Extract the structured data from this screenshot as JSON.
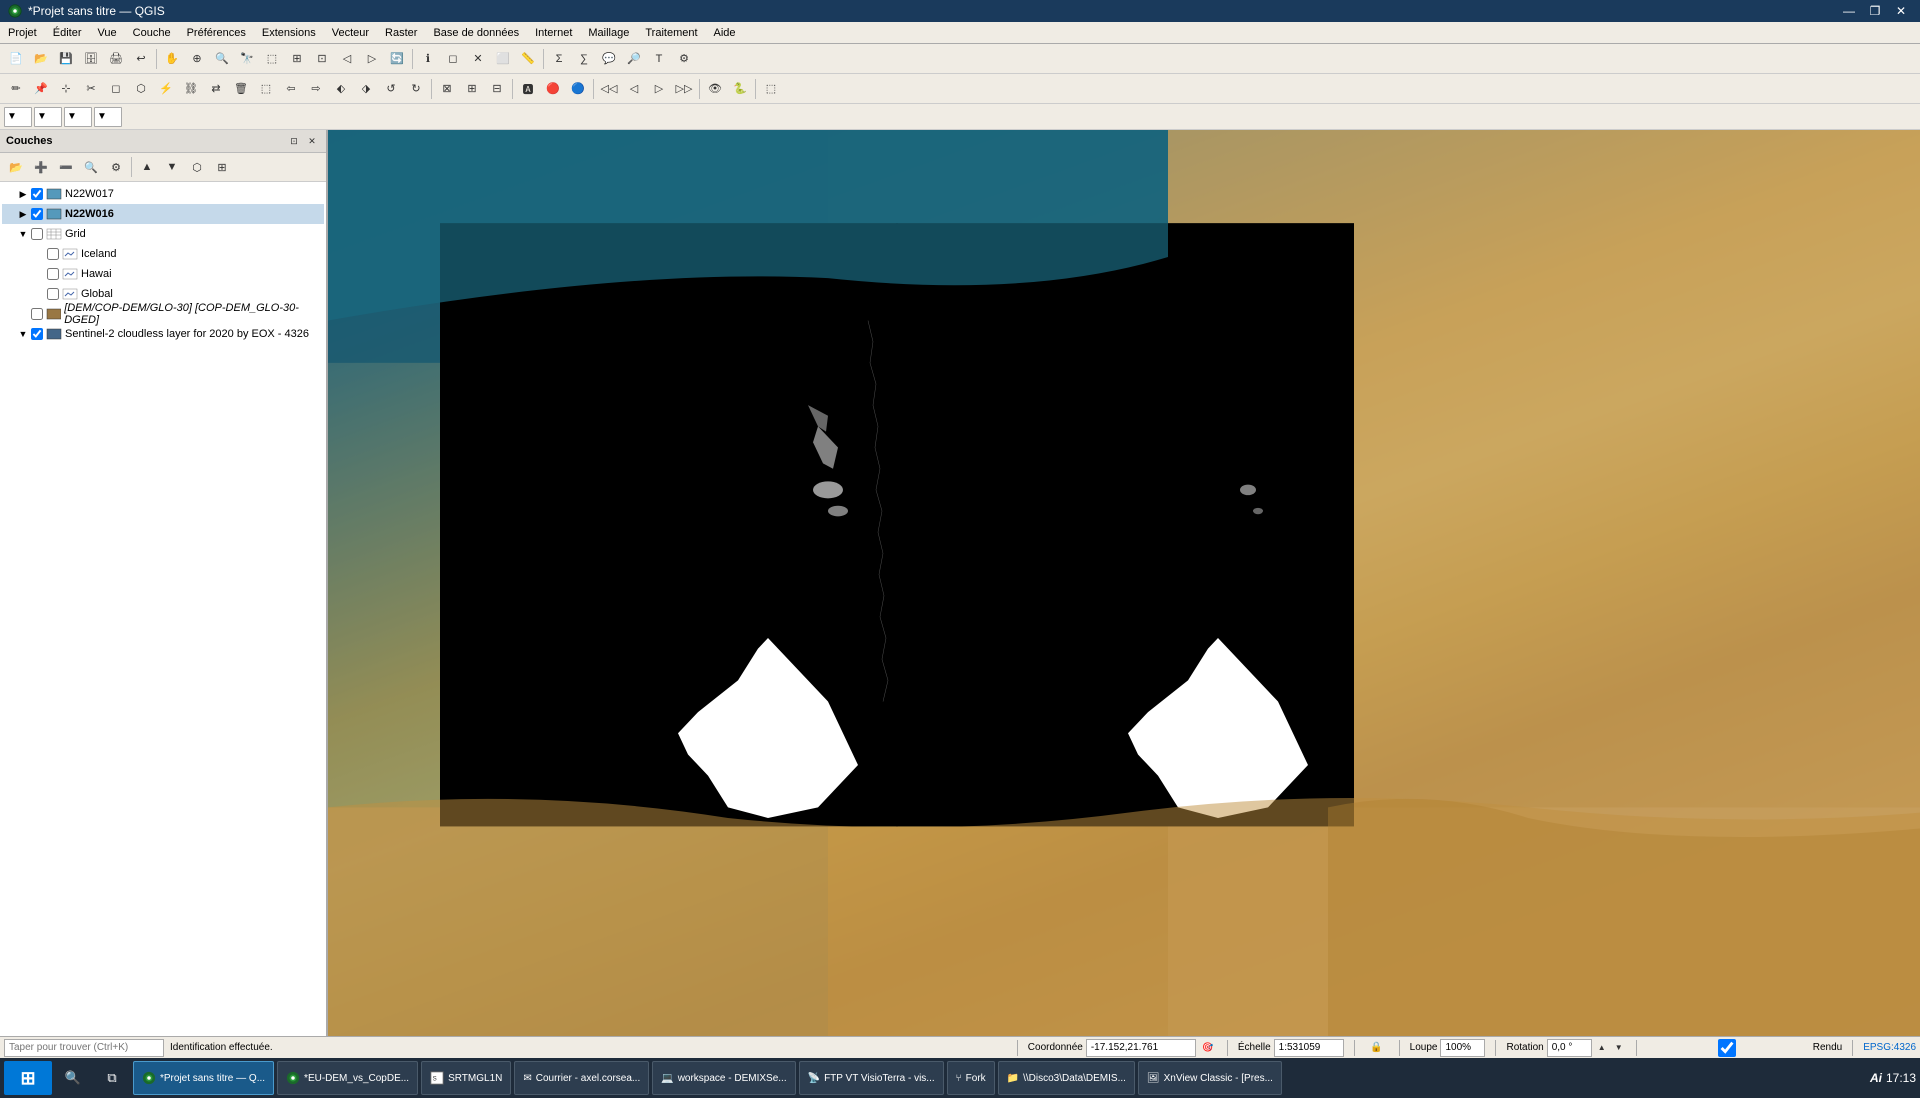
{
  "window": {
    "title": "*Projet sans titre — QGIS"
  },
  "titlebar": {
    "title": "*Projet sans titre — QGIS",
    "minimize": "—",
    "restore": "❐",
    "close": "✕"
  },
  "menubar": {
    "items": [
      "Projet",
      "Éditer",
      "Vue",
      "Couche",
      "Préférences",
      "Extensions",
      "Vecteur",
      "Raster",
      "Base de données",
      "Internet",
      "Maillage",
      "Traitement",
      "Aide"
    ]
  },
  "layers_panel": {
    "title": "Couches",
    "layers": [
      {
        "id": "N22W017",
        "name": "N22W017",
        "indent": 1,
        "checked": true,
        "type": "raster",
        "expanded": false
      },
      {
        "id": "N22W016",
        "name": "N22W016",
        "indent": 1,
        "checked": true,
        "type": "raster",
        "expanded": false,
        "selected": true
      },
      {
        "id": "Grid",
        "name": "Grid",
        "indent": 1,
        "checked": false,
        "type": "vector",
        "expanded": false
      },
      {
        "id": "Iceland",
        "name": "Iceland",
        "indent": 2,
        "checked": false,
        "type": "vector",
        "expanded": false
      },
      {
        "id": "Hawai",
        "name": "Hawai",
        "indent": 2,
        "checked": false,
        "type": "vector",
        "expanded": false
      },
      {
        "id": "Global",
        "name": "Global",
        "indent": 2,
        "checked": false,
        "type": "vector",
        "expanded": false
      },
      {
        "id": "DEM",
        "name": "[DEM/COP-DEM/GLO-30] [COP-DEM_GLO-30-DGED]",
        "indent": 1,
        "checked": false,
        "type": "raster-group",
        "expanded": false
      },
      {
        "id": "Sentinel",
        "name": "Sentinel-2 cloudless layer for 2020 by EOX - 4326",
        "indent": 1,
        "checked": true,
        "type": "raster",
        "expanded": true
      }
    ]
  },
  "statusbar": {
    "search_placeholder": "Taper pour trouver (Ctrl+K)",
    "identification": "Identification effectuée.",
    "coordonnee_label": "Coordonnée",
    "coordonnee_value": "-17.152,21.761",
    "echelle_label": "Échelle",
    "echelle_value": "1:531059",
    "loupe_label": "Loupe",
    "loupe_value": "100%",
    "rotation_label": "Rotation",
    "rotation_value": "0,0 °",
    "rendu_label": "Rendu",
    "epsg_label": "EPSG:4326"
  },
  "taskbar": {
    "items": [
      {
        "id": "start",
        "label": "⊞",
        "type": "start"
      },
      {
        "id": "search",
        "label": "🔍",
        "type": "icon"
      },
      {
        "id": "taskview",
        "label": "⧉",
        "type": "icon"
      },
      {
        "id": "qgis",
        "label": "*Projet sans titre — Q...",
        "active": true
      },
      {
        "id": "eudm",
        "label": "*EU-DEM_vs_CopDE..."
      },
      {
        "id": "srtmgl1n",
        "label": "SRTMGL1N"
      },
      {
        "id": "courrier",
        "label": "Courrier - axel.corsea..."
      },
      {
        "id": "workspace",
        "label": "workspace - DEMIXSe..."
      },
      {
        "id": "ftp1",
        "label": "FTP VT VisioTerra - vis..."
      },
      {
        "id": "fork",
        "label": "Fork"
      },
      {
        "id": "disco3",
        "label": "\\\\Disco3\\Data\\DEMIS..."
      },
      {
        "id": "xnview",
        "label": "XnView Classic - [Pres..."
      }
    ],
    "time": "17:13",
    "ai_label": "Ai"
  }
}
